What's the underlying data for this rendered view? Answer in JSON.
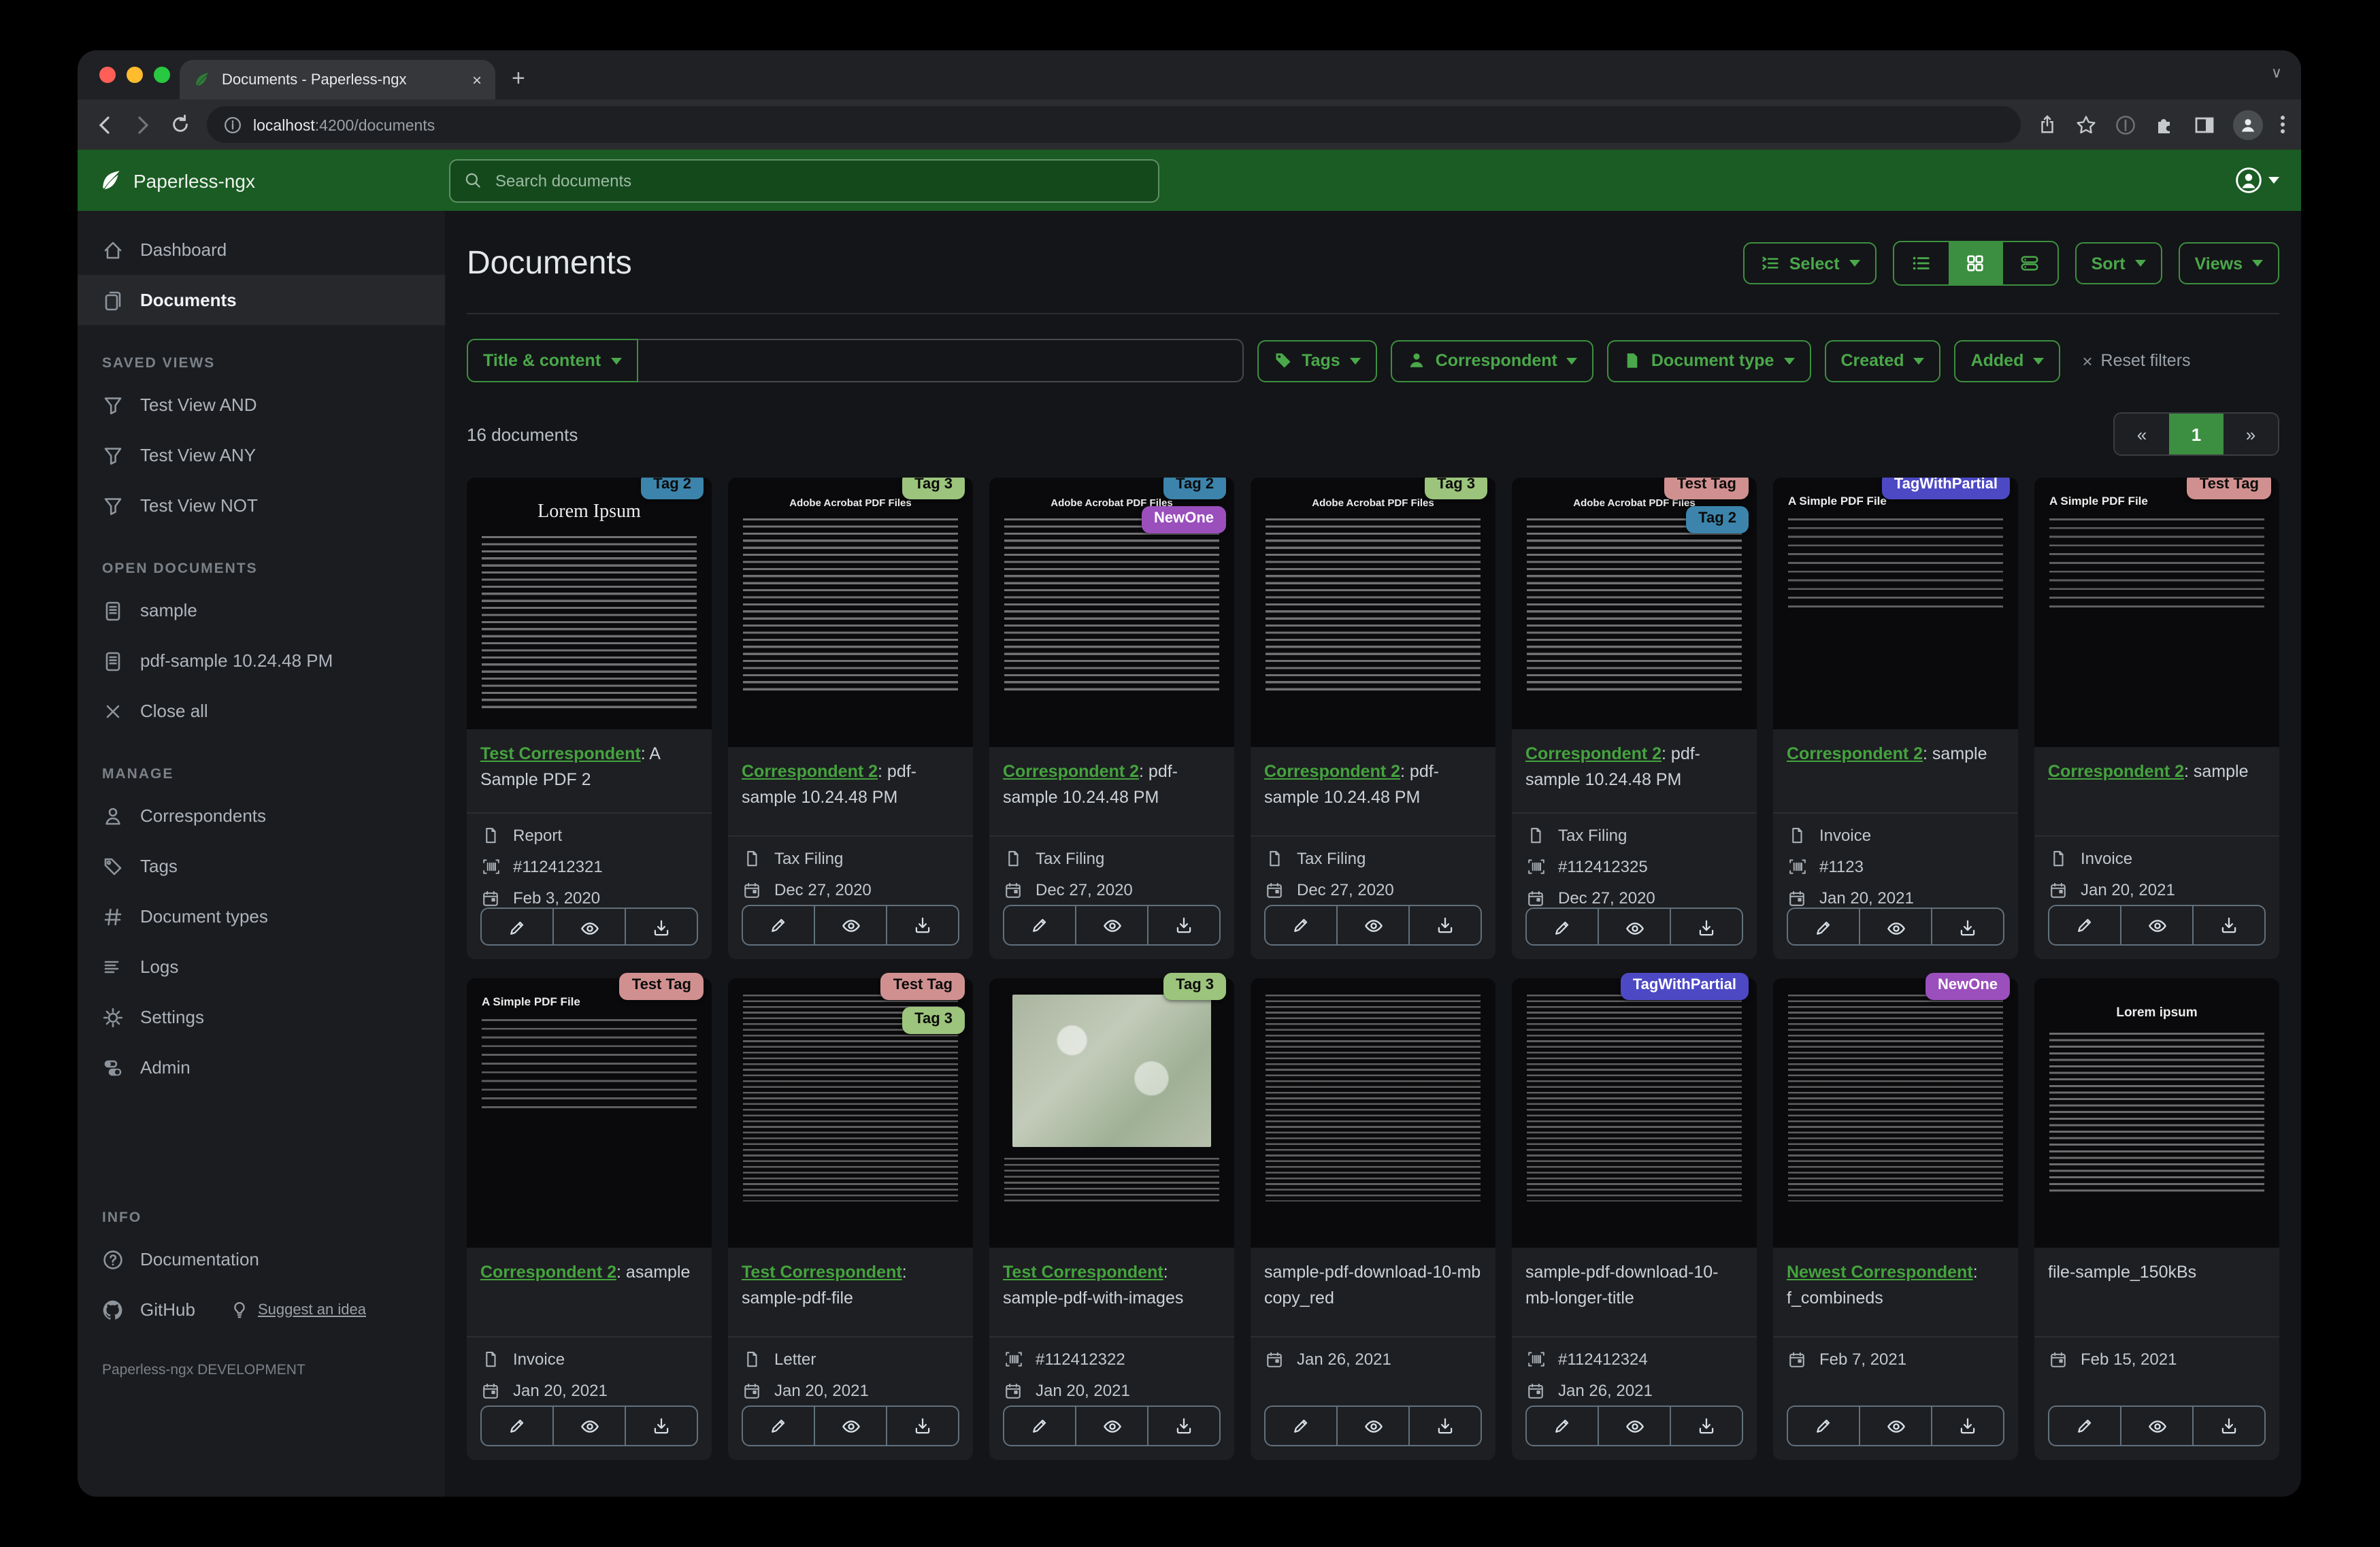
{
  "browser": {
    "tab_title": "Documents - Paperless-ngx",
    "url_host": "localhost",
    "url_rest": ":4200/documents",
    "new_tab": "+",
    "close_tab": "×",
    "chevron": "∨"
  },
  "header": {
    "app_name": "Paperless-ngx",
    "search_placeholder": "Search documents"
  },
  "sidebar": {
    "primary": [
      {
        "label": "Dashboard",
        "icon": "home"
      },
      {
        "label": "Documents",
        "icon": "docs",
        "active": true
      }
    ],
    "sections": [
      {
        "title": "SAVED VIEWS",
        "items": [
          {
            "label": "Test View AND",
            "icon": "funnel"
          },
          {
            "label": "Test View ANY",
            "icon": "funnel"
          },
          {
            "label": "Test View NOT",
            "icon": "funnel"
          }
        ]
      },
      {
        "title": "OPEN DOCUMENTS",
        "items": [
          {
            "label": "sample",
            "icon": "doctext"
          },
          {
            "label": "pdf-sample 10.24.48 PM",
            "icon": "doctext"
          },
          {
            "label": "Close all",
            "icon": "close"
          }
        ]
      },
      {
        "title": "MANAGE",
        "items": [
          {
            "label": "Correspondents",
            "icon": "person"
          },
          {
            "label": "Tags",
            "icon": "tag"
          },
          {
            "label": "Document types",
            "icon": "hash"
          },
          {
            "label": "Logs",
            "icon": "loglines"
          },
          {
            "label": "Settings",
            "icon": "gear"
          },
          {
            "label": "Admin",
            "icon": "toggles"
          }
        ]
      },
      {
        "title": "INFO",
        "gap": true,
        "items": [
          {
            "label": "Documentation",
            "icon": "question"
          },
          {
            "label": "GitHub",
            "icon": "github",
            "extra": {
              "label": "Suggest an idea",
              "icon": "bulb"
            }
          }
        ]
      }
    ],
    "footer_note": "Paperless-ngx DEVELOPMENT"
  },
  "toolbar": {
    "page_title": "Documents",
    "select_label": "Select",
    "sort_label": "Sort",
    "views_label": "Views"
  },
  "filters": {
    "field_label": "Title & content",
    "query_value": "",
    "buttons": [
      {
        "label": "Tags"
      },
      {
        "label": "Correspondent"
      },
      {
        "label": "Document type"
      },
      {
        "label": "Created"
      },
      {
        "label": "Added"
      }
    ],
    "reset_label": "Reset filters",
    "reset_x": "×"
  },
  "results": {
    "count_label": "16 documents",
    "page_prev": "«",
    "page_current": "1",
    "page_next": "»"
  },
  "tag_colors": {
    "Tag 2": {
      "bg": "#3c84ab",
      "fg": "#0b0b0b"
    },
    "Tag 3": {
      "bg": "#9cc47c",
      "fg": "#0b0b0b"
    },
    "Test Tag": {
      "bg": "#d19090",
      "fg": "#0b0b0b"
    },
    "NewOne": {
      "bg": "#9a4fbc",
      "fg": "#ffffff"
    },
    "TagWithPartial": {
      "bg": "#4d49c5",
      "fg": "#ffffff"
    }
  },
  "cards": [
    {
      "tags": [
        "Tag 2"
      ],
      "thumb": {
        "kind": "serif",
        "title": "Lorem Ipsum"
      },
      "correspondent": "Test Correspondent",
      "title": "A Sample PDF 2",
      "doc_type": "Report",
      "asn": "#112412321",
      "date": "Feb 3, 2020"
    },
    {
      "tags": [
        "Tag 3"
      ],
      "thumb": {
        "kind": "acrobat",
        "title": "Adobe Acrobat PDF Files"
      },
      "correspondent": "Correspondent 2",
      "title": "pdf-sample 10.24.48 PM",
      "doc_type": "Tax Filing",
      "asn": "",
      "date": "Dec 27, 2020"
    },
    {
      "tags": [
        "Tag 2",
        "NewOne"
      ],
      "thumb": {
        "kind": "acrobat",
        "title": "Adobe Acrobat PDF Files"
      },
      "correspondent": "Correspondent 2",
      "title": "pdf-sample 10.24.48 PM",
      "doc_type": "Tax Filing",
      "asn": "",
      "date": "Dec 27, 2020"
    },
    {
      "tags": [
        "Tag 3"
      ],
      "thumb": {
        "kind": "acrobat",
        "title": "Adobe Acrobat PDF Files"
      },
      "correspondent": "Correspondent 2",
      "title": "pdf-sample 10.24.48 PM",
      "doc_type": "Tax Filing",
      "asn": "",
      "date": "Dec 27, 2020"
    },
    {
      "tags": [
        "Test Tag",
        "Tag 2"
      ],
      "thumb": {
        "kind": "acrobat",
        "title": "Adobe Acrobat PDF Files"
      },
      "correspondent": "Correspondent 2",
      "title": "pdf-sample 10.24.48 PM",
      "doc_type": "Tax Filing",
      "asn": "#112412325",
      "date": "Dec 27, 2020"
    },
    {
      "tags": [
        "TagWithPartial"
      ],
      "thumb": {
        "kind": "simple",
        "title": "A Simple PDF File"
      },
      "correspondent": "Correspondent 2",
      "title": "sample",
      "doc_type": "Invoice",
      "asn": "#1123",
      "date": "Jan 20, 2021"
    },
    {
      "tags": [
        "Test Tag"
      ],
      "thumb": {
        "kind": "simple",
        "title": "A Simple PDF File"
      },
      "correspondent": "Correspondent 2",
      "title": "sample",
      "doc_type": "Invoice",
      "asn": "",
      "date": "Jan 20, 2021"
    },
    {
      "tags": [
        "Test Tag"
      ],
      "thumb": {
        "kind": "simple",
        "title": "A Simple PDF File"
      },
      "correspondent": "Correspondent 2",
      "title": "asample",
      "doc_type": "Invoice",
      "asn": "",
      "date": "Jan 20, 2021"
    },
    {
      "tags": [
        "Test Tag",
        "Tag 3"
      ],
      "thumb": {
        "kind": "dense",
        "title": ""
      },
      "correspondent": "Test Correspondent",
      "title": "sample-pdf-file",
      "doc_type": "Letter",
      "asn": "",
      "date": "Jan 20, 2021"
    },
    {
      "tags": [
        "Tag 3"
      ],
      "thumb": {
        "kind": "map",
        "title": ""
      },
      "correspondent": "Test Correspondent",
      "title": "sample-pdf-with-images",
      "doc_type": "",
      "asn": "#112412322",
      "date": "Jan 20, 2021"
    },
    {
      "tags": [],
      "thumb": {
        "kind": "dense",
        "title": ""
      },
      "correspondent": "",
      "title": "sample-pdf-download-10-mb copy_red",
      "doc_type": "",
      "asn": "",
      "date": "Jan 26, 2021"
    },
    {
      "tags": [
        "TagWithPartial"
      ],
      "thumb": {
        "kind": "dense",
        "title": ""
      },
      "correspondent": "",
      "title": "sample-pdf-download-10-mb-longer-title",
      "doc_type": "",
      "asn": "#112412324",
      "date": "Jan 26, 2021"
    },
    {
      "tags": [
        "NewOne"
      ],
      "thumb": {
        "kind": "dense",
        "title": ""
      },
      "correspondent": "Newest Correspondent",
      "title": "f_combineds",
      "doc_type": "",
      "asn": "",
      "date": "Feb 7, 2021"
    },
    {
      "tags": [],
      "thumb": {
        "kind": "lorem-center",
        "title": "Lorem ipsum"
      },
      "correspondent": "",
      "title": "file-sample_150kBs",
      "doc_type": "",
      "asn": "",
      "date": "Feb 15, 2021"
    }
  ]
}
